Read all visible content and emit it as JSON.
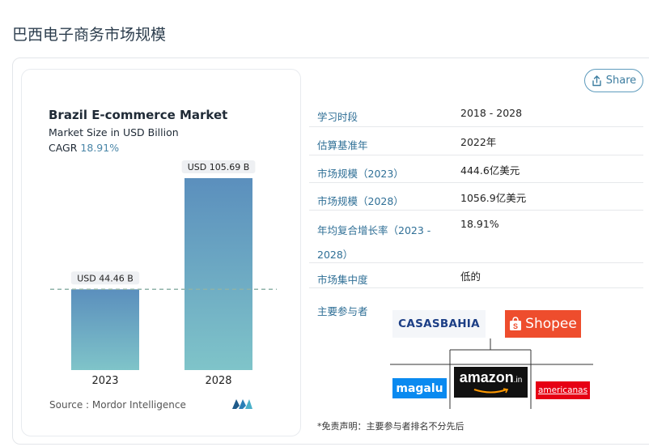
{
  "page_title": "巴西电子商务市场规模",
  "share": {
    "label": "Share",
    "icon": "share-icon"
  },
  "chart_card": {
    "title": "Brazil E-commerce Market",
    "subtitle": "Market Size in USD Billion",
    "cagr_label": "CAGR",
    "cagr_value": "18.91%",
    "source_text": "Source :  Mordor Intelligence",
    "logo_text": "MI"
  },
  "chart_data": {
    "type": "bar",
    "categories": [
      "2023",
      "2028"
    ],
    "values": [
      44.46,
      105.69
    ],
    "data_labels": [
      "USD 44.46 B",
      "USD 105.69 B"
    ],
    "title": "Brazil E-commerce Market",
    "subtitle": "Market Size in USD Billion",
    "xlabel": "",
    "ylabel": "",
    "ylim": [
      0,
      105.69
    ],
    "grid": false,
    "reference_line_at": 44.46
  },
  "info_rows": [
    {
      "label": "学习时段",
      "value": "2018 - 2028"
    },
    {
      "label": "估算基准年",
      "value": "2022年"
    },
    {
      "label": "市场规模（2023）",
      "value": "444.6亿美元"
    },
    {
      "label": "市场规模（2028）",
      "value": "1056.9亿美元"
    },
    {
      "label": "年均复合增长率（2023 - 2028）",
      "value": "18.91%"
    },
    {
      "label": "市场集中度",
      "value": "低的"
    }
  ],
  "players_label": "主要参与者",
  "players": {
    "casas_bahia": "CASASBAHIA",
    "shopee": "Shopee",
    "magalu": "magalu",
    "amazon": "amazon",
    "amazon_suffix": ".in",
    "americanas": "americanas"
  },
  "disclaimer": "*免责声明：主要参与者排名不分先后",
  "colors": {
    "bar_top": "#5b8fbd",
    "bar_bottom": "#7fc4c9",
    "accent": "#3d7da0",
    "shopee": "#ee4d2d",
    "magalu": "#0a8af0",
    "americanas": "#e60014"
  }
}
